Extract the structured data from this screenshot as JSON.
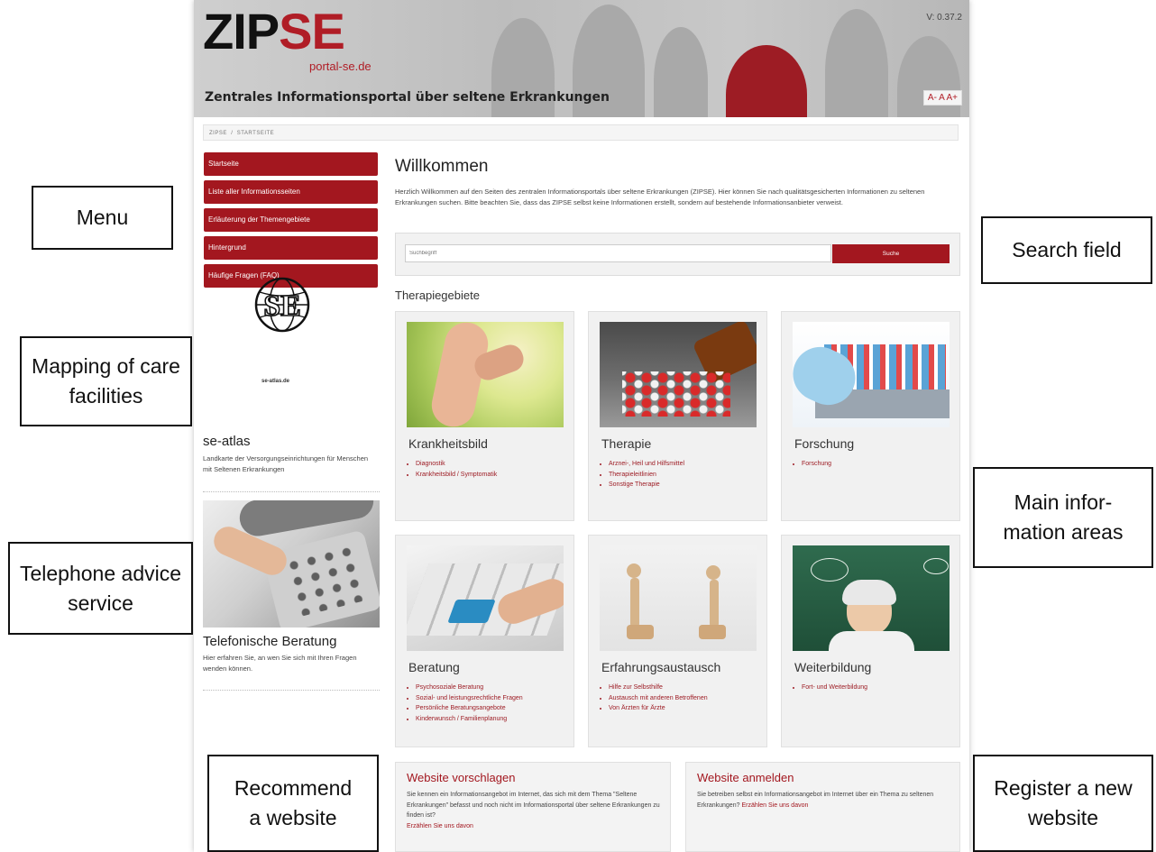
{
  "header": {
    "logo_main": "ZIP",
    "logo_accent": "SE",
    "logo_sub": "portal-se.de",
    "tagline": "Zentrales Informationsportal über seltene Erkrankungen",
    "version": "V: 0.37.2",
    "font_controls": "A- A A+"
  },
  "breadcrumb": {
    "home": "ZIPSE",
    "separator": "/",
    "current": "STARTSEITE"
  },
  "menu": {
    "items": [
      {
        "label": "Startseite"
      },
      {
        "label": "Liste aller Informationsseiten"
      },
      {
        "label": "Erläuterung der Themengebiete"
      },
      {
        "label": "Hintergrund"
      },
      {
        "label": "Häufige Fragen (FAQ)"
      }
    ]
  },
  "sidebar": {
    "atlas_logo_text": "SE",
    "atlas_caption": "se-atlas.de",
    "atlas_title": "se-atlas",
    "atlas_text": "Landkarte der Versorgungseinrichtungen für Menschen mit Seltenen Erkrankungen",
    "phone_title": "Telefonische Beratung",
    "phone_text": "Hier erfahren Sie, an wen Sie sich mit Ihren Fragen wenden können."
  },
  "welcome": {
    "title": "Willkommen",
    "text": "Herzlich Willkommen auf den Seiten des zentralen Informationsportals über seltene Erkrankungen (ZIPSE). Hier können Sie nach qualitätsgesicherten Informationen zu seltenen Erkrankungen suchen. Bitte beachten Sie, dass das ZIPSE selbst keine Informationen erstellt, sondern auf bestehende Informationsanbieter verweist."
  },
  "search": {
    "placeholder": "Suchbegriff",
    "button": "Suche"
  },
  "therapy": {
    "heading": "Therapiegebiete",
    "cards": [
      {
        "title": "Krankheitsbild",
        "links": [
          "Diagnostik",
          "Krankheitsbild / Symptomatik"
        ]
      },
      {
        "title": "Therapie",
        "links": [
          "Arznei-, Heil und Hilfsmittel",
          "Therapieleitlinien",
          "Sonstige Therapie"
        ]
      },
      {
        "title": "Forschung",
        "links": [
          "Forschung"
        ]
      },
      {
        "title": "Beratung",
        "links": [
          "Psychosoziale Beratung",
          "Sozial- und leistungsrechtliche Fragen",
          "Persönliche Beratungsangebote",
          "Kinderwunsch / Familienplanung"
        ]
      },
      {
        "title": "Erfahrungsaustausch",
        "links": [
          "Hilfe zur Selbsthilfe",
          "Austausch mit anderen Betroffenen",
          "Von Ärzten für Ärzte"
        ]
      },
      {
        "title": "Weiterbildung",
        "links": [
          "Fort- und Weiterbildung"
        ]
      }
    ]
  },
  "bottom": {
    "suggest": {
      "title": "Website vorschlagen",
      "text": "Sie kennen ein Informationsangebot im Internet, das sich mit dem Thema \"Seltene Erkrankungen\" befasst und noch nicht im Informationsportal über seltene Erkrankungen zu finden ist?",
      "link": "Erzählen Sie uns davon"
    },
    "register": {
      "title": "Website anmelden",
      "text": "Sie betreiben selbst ein Informationsangebot im Internet über ein Thema zu seltenen Erkrankungen?",
      "link": "Erzählen Sie uns davon"
    }
  },
  "callouts": {
    "menu": "Menu",
    "mapping": "Mapping of care facilities",
    "telephone": "Telephone advice service",
    "recommend": "Recommend a website",
    "search": "Search field",
    "main": "Main infor-mation areas",
    "register": "Register a new website"
  },
  "colors": {
    "accent": "#a3171f",
    "header_bg": "#c4c4c4",
    "card_bg": "#f1f1f1"
  }
}
